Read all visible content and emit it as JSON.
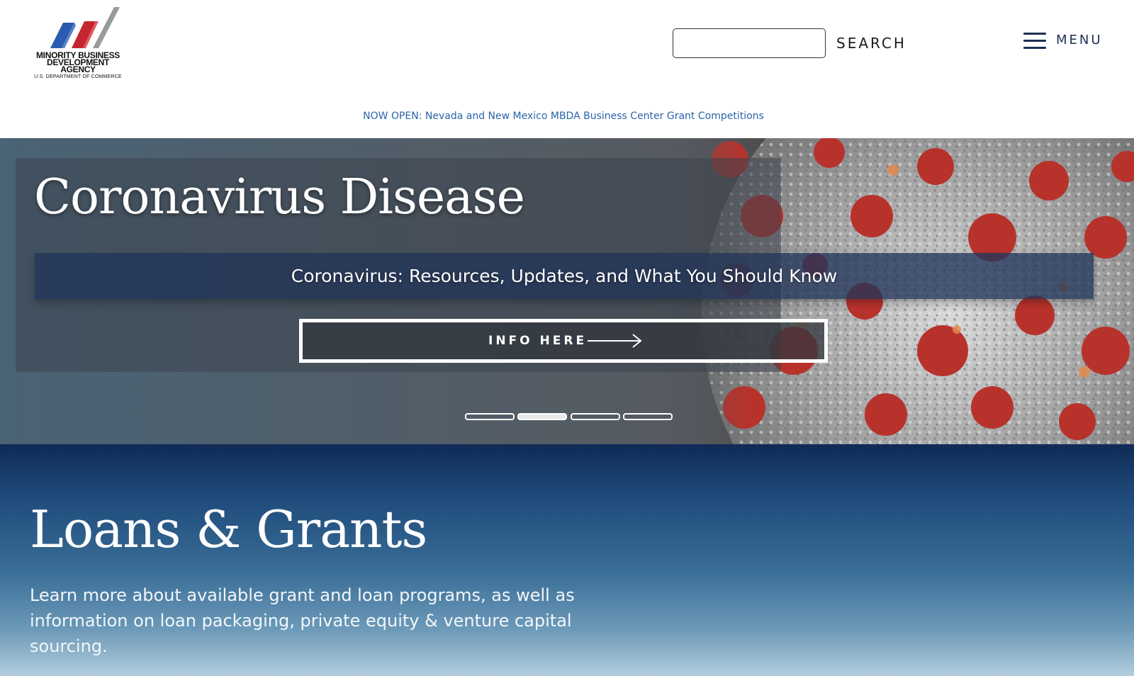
{
  "header": {
    "logo": {
      "line1": "MINORITY BUSINESS",
      "line2": "DEVELOPMENT AGENCY",
      "line3": "U.S. DEPARTMENT OF COMMERCE",
      "colors": [
        "#2a5bb0",
        "#c4252f",
        "#9a9a9a"
      ]
    },
    "search": {
      "placeholder": "",
      "value": "",
      "button_label": "SEARCH"
    },
    "menu": {
      "label": "MENU",
      "icon": "hamburger-icon"
    }
  },
  "announcement": {
    "text": "NOW OPEN: Nevada and New Mexico MBDA Business Center Grant Competitions",
    "color": "#2a64a8"
  },
  "hero": {
    "title": "Coronavirus Disease",
    "subtitle": "Coronavirus: Resources, Updates, and What You Should Know",
    "button_label": "INFO HERE",
    "button_icon": "arrow-right-icon",
    "slides": {
      "count": 4,
      "active_index": 1
    }
  },
  "loans": {
    "title": "Loans & Grants",
    "description": "Learn more about available grant and loan programs, as well as information on loan packaging, private equity & venture capital sourcing."
  }
}
